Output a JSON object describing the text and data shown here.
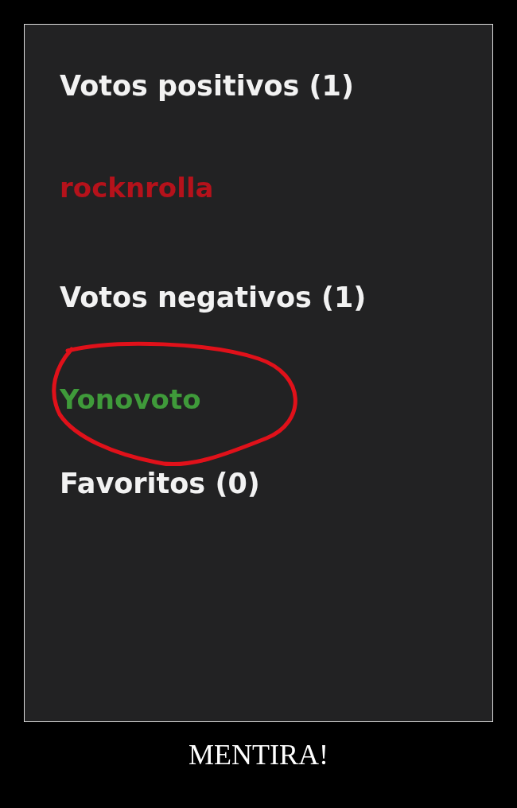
{
  "panel": {
    "sections": [
      {
        "heading": "Votos positivos (1)",
        "users": [
          {
            "name": "rocknrolla",
            "color": "#b5121b",
            "circled": false
          }
        ]
      },
      {
        "heading": "Votos negativos (1)",
        "users": [
          {
            "name": "Yonovoto",
            "color": "#3f9a3a",
            "circled": true
          }
        ]
      },
      {
        "heading": "Favoritos (0)"
      }
    ]
  },
  "caption": "MENTIRA!"
}
